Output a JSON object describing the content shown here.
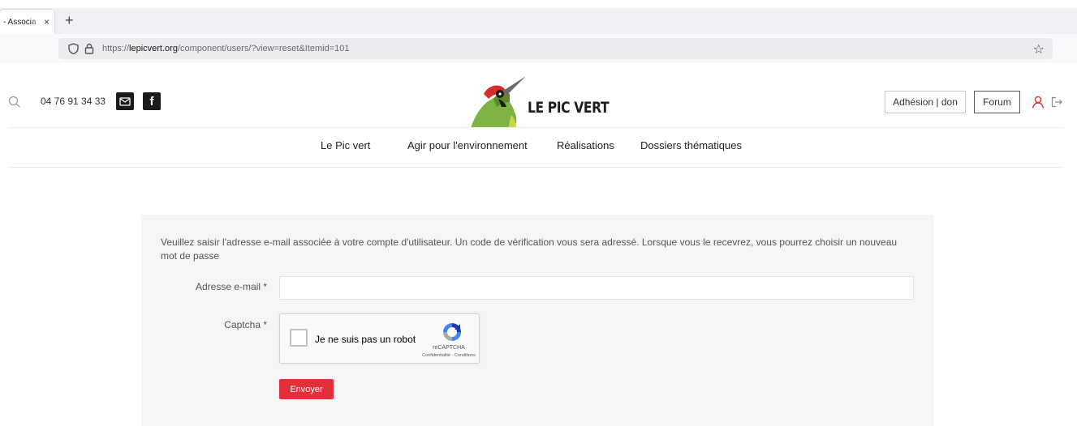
{
  "browser": {
    "tab_title": "- Associa",
    "tab_close": "×",
    "new_tab": "+",
    "url_prefix": "https://",
    "url_host": "lepicvert.org",
    "url_path": "/component/users/?view=reset&Itemid=101",
    "bookmark_icon": "star-icon"
  },
  "header": {
    "phone": "04 76 91 34 33",
    "mail_icon": "mail-icon",
    "facebook_label": "f",
    "logo_text": "LE PIC VERT",
    "adhesion_label": "Adhésion | don",
    "forum_label": "Forum",
    "user_icon": "user-icon",
    "logout_icon": "logout-icon",
    "search_icon": "search-icon"
  },
  "nav": {
    "items": [
      {
        "label": "Le Pic vert"
      },
      {
        "label": "Agir pour l'environnement"
      },
      {
        "label": "Réalisations"
      },
      {
        "label": "Dossiers thématiques"
      }
    ]
  },
  "form": {
    "intro": "Veuillez saisir l'adresse e-mail associée à votre compte d'utilisateur. Un code de vérification vous sera adressé. Lorsque vous le recevrez, vous pourrez choisir un nouveau mot de passe",
    "email_label": "Adresse e-mail *",
    "email_value": "",
    "captcha_label": "Captcha *",
    "recaptcha_text": "Je ne suis pas un robot",
    "recaptcha_brand": "reCAPTCHA",
    "recaptcha_links": "Confidentialité - Conditions",
    "submit_label": "Envoyer"
  },
  "colors": {
    "accent_red": "#e2303a",
    "woodpecker_green": "#7cb342"
  }
}
